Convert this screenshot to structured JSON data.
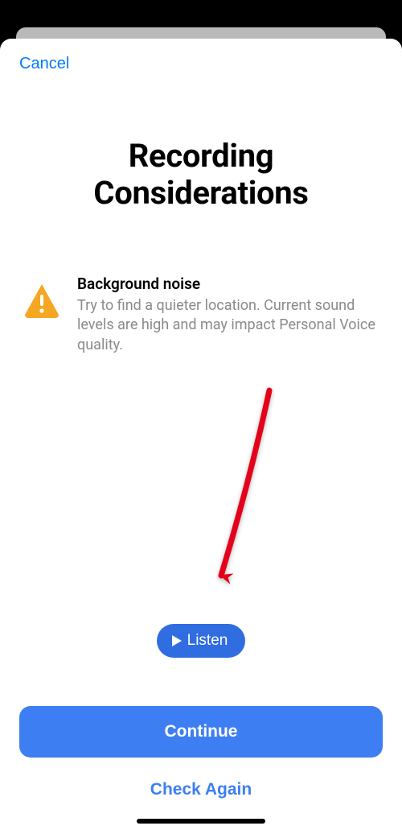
{
  "nav": {
    "cancel_label": "Cancel"
  },
  "page": {
    "title_line1": "Recording",
    "title_line2": "Considerations"
  },
  "consideration": {
    "icon": "warning-triangle-icon",
    "heading": "Background noise",
    "body": "Try to find a quieter location. Current sound levels are high and may impact Personal Voice quality."
  },
  "listen": {
    "label": "Listen",
    "icon": "play-icon"
  },
  "actions": {
    "continue_label": "Continue",
    "check_again_label": "Check Again"
  },
  "colors": {
    "ios_blue": "#007aff",
    "button_blue": "#3d7ff3",
    "pill_blue": "#2f6de1",
    "warning_orange": "#f5a623",
    "secondary_text": "#8a8a8e",
    "annotation_red": "#e4001b"
  }
}
